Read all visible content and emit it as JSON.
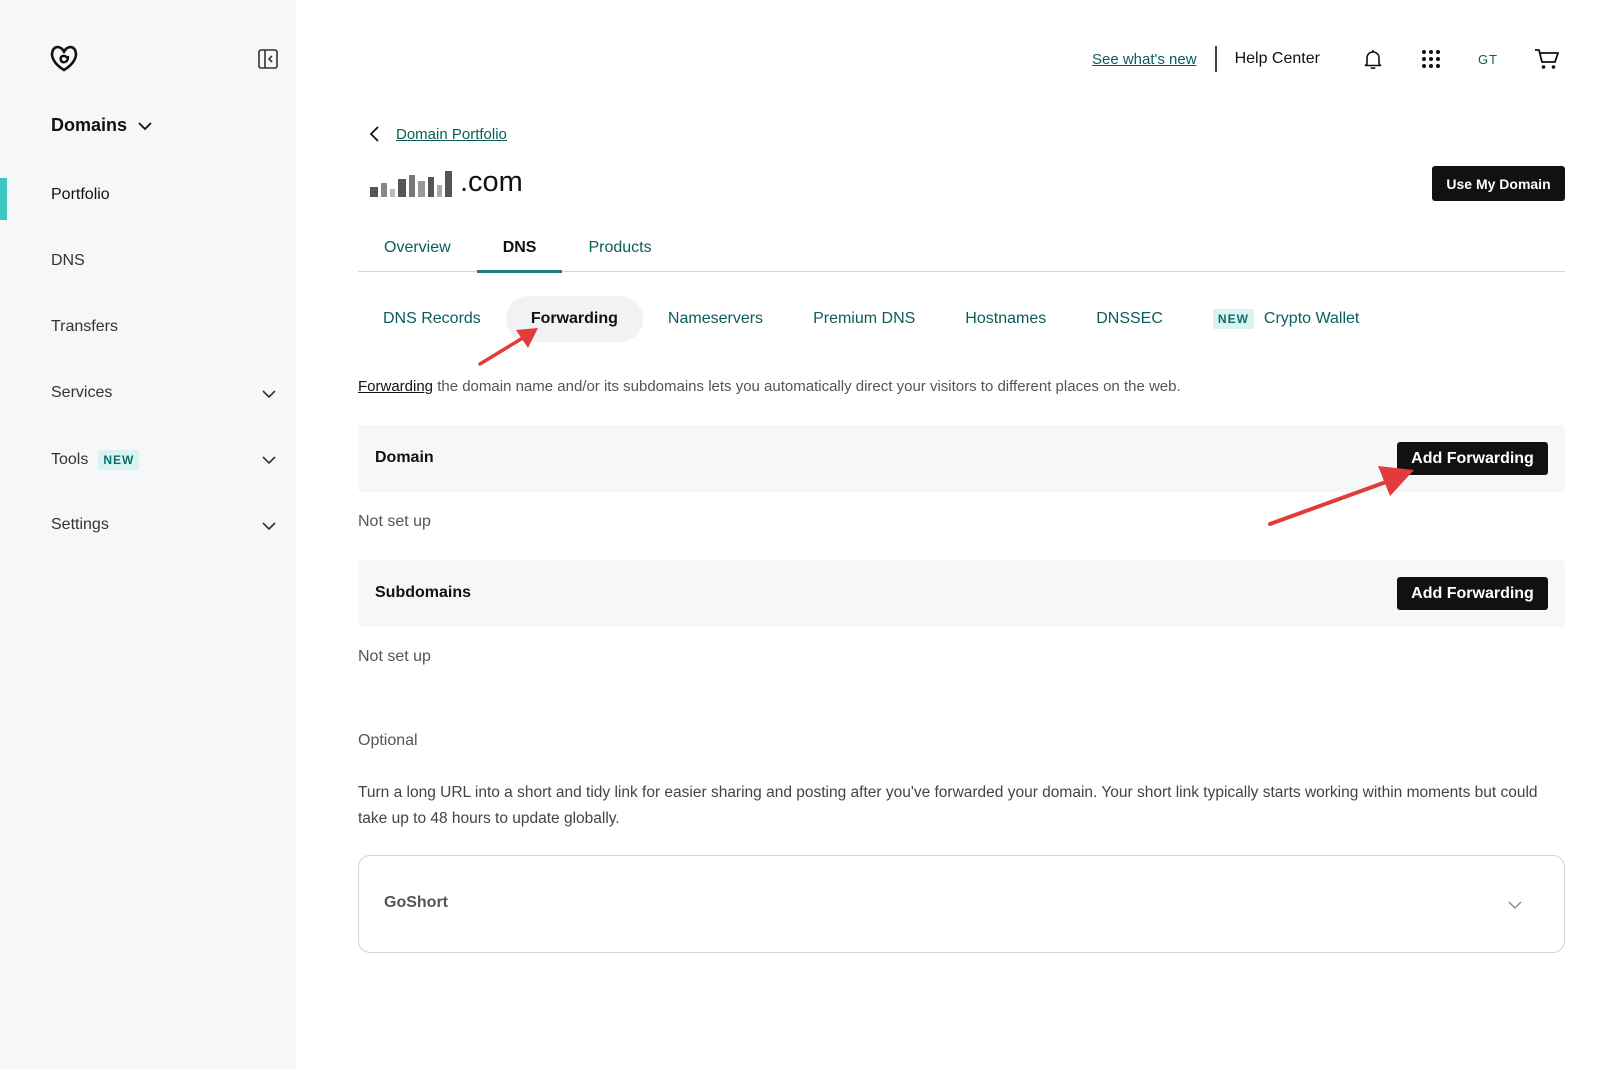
{
  "sidebar": {
    "section_title": "Domains",
    "items": [
      {
        "label": "Portfolio"
      },
      {
        "label": "DNS"
      },
      {
        "label": "Transfers"
      },
      {
        "label": "Services"
      },
      {
        "label": "Tools",
        "badge": "NEW"
      },
      {
        "label": "Settings"
      }
    ]
  },
  "topbar": {
    "whats_new": "See what's new",
    "help_center": "Help Center",
    "user_initials": "GT"
  },
  "breadcrumb": {
    "label": "Domain Portfolio"
  },
  "domain": {
    "suffix": ".com"
  },
  "use_domain_button": "Use My Domain",
  "tabs": [
    {
      "label": "Overview"
    },
    {
      "label": "DNS"
    },
    {
      "label": "Products"
    }
  ],
  "subtabs": [
    {
      "label": "DNS Records"
    },
    {
      "label": "Forwarding"
    },
    {
      "label": "Nameservers"
    },
    {
      "label": "Premium DNS"
    },
    {
      "label": "Hostnames"
    },
    {
      "label": "DNSSEC"
    },
    {
      "label": "Crypto Wallet",
      "badge": "NEW"
    }
  ],
  "description": {
    "link": "Forwarding",
    "text": " the domain name and/or its subdomains lets you automatically direct your visitors to different places on the web."
  },
  "forwarding": {
    "domain_label": "Domain",
    "subdomains_label": "Subdomains",
    "add_label": "Add Forwarding",
    "domain_status": "Not set up",
    "subdomains_status": "Not set up"
  },
  "optional": {
    "title": "Optional",
    "text": "Turn a long URL into a short and tidy link for easier sharing and posting after you've forwarded your domain. Your short link typically starts working within moments but could take up to 48 hours to update globally."
  },
  "goshort": {
    "label": "GoShort"
  },
  "colors": {
    "accent": "#0b5d5a",
    "active_bar": "#3ec6c2",
    "annotation": "#e23b3b"
  }
}
